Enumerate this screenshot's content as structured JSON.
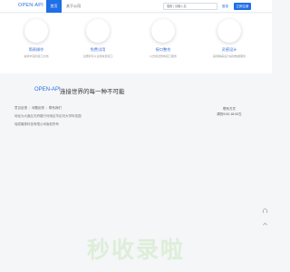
{
  "header": {
    "logo": "OPEN-API",
    "nav": [
      "首页",
      "关于公司"
    ],
    "search_placeholder": "搜索 | 请输入名",
    "login": "登录",
    "register": "立即注册"
  },
  "features": [
    {
      "title": "简易操作",
      "desc": "提供丰富的接口文档"
    },
    {
      "title": "免费试用",
      "desc": "注册即可以试用免费接口"
    },
    {
      "title": "接口整合",
      "desc": "以去用法整体接口服务"
    },
    {
      "title": "灵感设计",
      "desc": "提供精美设计提供数据服务"
    }
  ],
  "slogan": {
    "brand": "OPEN-API",
    "text": "连接世界的每一种不可能"
  },
  "footer": {
    "links": [
      "意见反馈",
      "问题反馈",
      "联系我们"
    ],
    "address": "地址为大鑫区天府路行河地区华区河大学科技园",
    "company": "瑞成隆泰科技有限公司版权所有",
    "contact_label": "联系方式",
    "contact_value": "周的9:00-18:00左"
  },
  "watermark": "秒收录啦",
  "icons": {
    "side_top": "headset-icon",
    "side_bottom": "arrow-up-icon"
  }
}
